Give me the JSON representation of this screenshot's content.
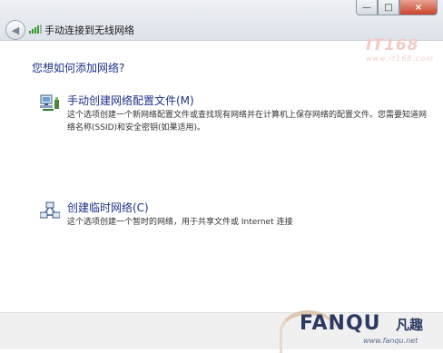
{
  "window": {
    "title": "手动连接到无线网络",
    "controls": {
      "minimize": "—",
      "maximize": "□",
      "close": "×"
    }
  },
  "main": {
    "heading": "您想如何添加网络?",
    "options": [
      {
        "icon": "network-computer-icon",
        "title": "手动创建网络配置文件(M)",
        "description": "这个选项创建一个新网络配置文件或查找现有网络并在计算机上保存网络的配置文件。您需要知道网络名称(SSID)和安全密钥(如果适用)。"
      },
      {
        "icon": "adhoc-network-icon",
        "title": "创建临时网络(C)",
        "description": "这个选项创建一个暂时的网络，用于共享文件或 Internet 连接"
      }
    ]
  },
  "watermark": {
    "top_text": "IT168",
    "top_url": "www.it168.com"
  },
  "logo": {
    "brand": "FANQU",
    "cn": "凡趣",
    "url": "www.fanqu.net"
  },
  "colors": {
    "link_blue": "#1e3287",
    "close_red": "#c9442a"
  }
}
